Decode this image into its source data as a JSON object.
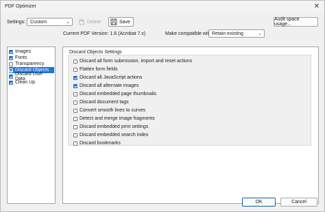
{
  "window": {
    "title": "PDF Optimizer",
    "close_glyph": "✕"
  },
  "toolbar": {
    "settings_label": "Settings:",
    "settings_value": "Custom",
    "delete_label": "Delete",
    "save_label": "Save",
    "audit_label": "Audit space usage..."
  },
  "info": {
    "pdf_version": "Current PDF Version: 1.6 (Acrobat 7.x)",
    "compat_label": "Make compatible with:",
    "compat_value": "Retain existing"
  },
  "nav": {
    "items": [
      {
        "label": "Images",
        "checked": true
      },
      {
        "label": "Fonts",
        "checked": true
      },
      {
        "label": "Transparency",
        "checked": false
      },
      {
        "label": "Discard Objects",
        "checked": true,
        "selected": true
      },
      {
        "label": "Discard User Data",
        "checked": true
      },
      {
        "label": "Clean Up",
        "checked": true
      }
    ]
  },
  "panel": {
    "title": "Discard Objects Settings",
    "options": [
      {
        "label": "Discard all form submission, import and reset actions",
        "checked": false
      },
      {
        "label": "Flatten form fields",
        "checked": false
      },
      {
        "label": "Discard all JavaScript actions",
        "checked": true
      },
      {
        "label": "Discard all alternate images",
        "checked": true
      },
      {
        "label": "Discard embedded page thumbnails",
        "checked": false
      },
      {
        "label": "Discard document tags",
        "checked": false
      },
      {
        "label": "Convert smooth lines to curves",
        "checked": false
      },
      {
        "label": "Detect and merge image fragments",
        "checked": false
      },
      {
        "label": "Discard embedded print settings",
        "checked": false
      },
      {
        "label": "Discard embedded search index",
        "checked": false
      },
      {
        "label": "Discard bookmarks",
        "checked": false
      }
    ]
  },
  "footer": {
    "ok_label": "OK",
    "cancel_label": "Cancel"
  },
  "colors": {
    "accent": "#1f77d0",
    "check": "#1d6fc7",
    "disabled": "#a8a8a8"
  }
}
